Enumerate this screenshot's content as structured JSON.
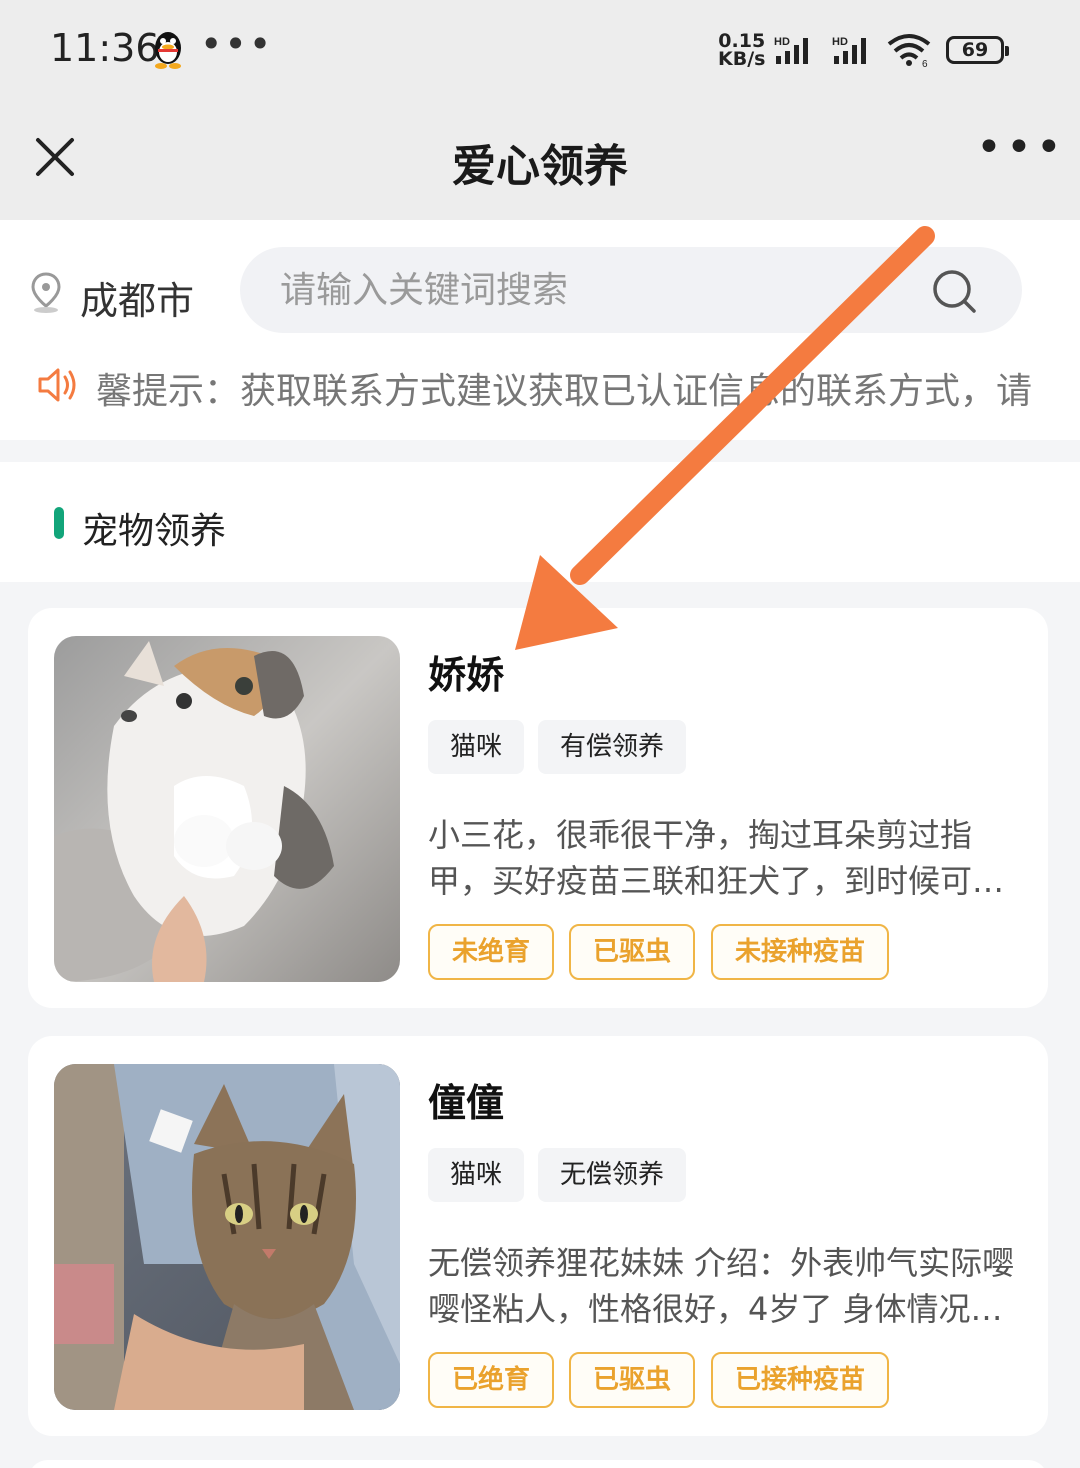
{
  "status_bar": {
    "time": "11:36",
    "dots": "•••",
    "net_speed_value": "0.15",
    "net_speed_unit": "KB/s",
    "battery": "69",
    "icons": [
      "qq-icon",
      "signal-icon",
      "wifi-icon",
      "battery-icon"
    ]
  },
  "title_bar": {
    "title": "爱心领养",
    "close_icon": "close-icon",
    "more_label": "•••"
  },
  "search": {
    "city": "成都市",
    "placeholder": "请输入关键词搜索",
    "notice": "馨提示：获取联系方式建议获取已认证信息的联系方式，请"
  },
  "section": {
    "title": "宠物领养",
    "accent_color": "#12a57a"
  },
  "pets": [
    {
      "name": "娇娇",
      "tags": [
        "猫咪",
        "有偿领养"
      ],
      "description": "小三花，很乖很干净，掏过耳朵剪过指甲，买好疫苗三联和狂犬了，到时候可…",
      "badges": [
        "未绝育",
        "已驱虫",
        "未接种疫苗"
      ]
    },
    {
      "name": "僮僮",
      "tags": [
        "猫咪",
        "无偿领养"
      ],
      "description": "无偿领养狸花妹妹 介绍：外表帅气实际嘤嘤怪粘人，性格很好，4岁了 身体情况…",
      "badges": [
        "已绝育",
        "已驱虫",
        "已接种疫苗"
      ]
    }
  ],
  "colors": {
    "badge": "#eaa22d",
    "arrow": "#f47b40"
  }
}
